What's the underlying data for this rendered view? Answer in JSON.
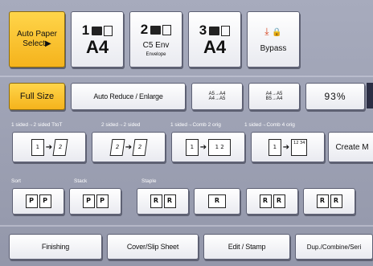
{
  "paper_select": {
    "auto": "Auto Paper\nSelect",
    "auto_line1": "Auto Paper",
    "auto_line2": "Select▶",
    "tray1": {
      "num": "1",
      "size": "A4"
    },
    "tray2": {
      "num": "2",
      "size": "C5 Env",
      "sub": "Envelope"
    },
    "tray3": {
      "num": "3",
      "size": "A4"
    },
    "bypass": "Bypass"
  },
  "zoom": {
    "full": "Full Size",
    "auto_reduce": "Auto Reduce / Enlarge",
    "preset1_a": "A5→A4",
    "preset1_b": "A4→A5",
    "preset2_a": "A4→A5",
    "preset2_b": "B5→A4",
    "percent": "93%"
  },
  "duplex": {
    "labels": [
      "1 sided→2 sided TtoT",
      "2 sided→2 sided",
      "1 sided→Comb 2 orig",
      "1 sided→Comb 4 orig"
    ],
    "create_margin": "Create M"
  },
  "finishing_labels": {
    "sort": "Sort",
    "stack": "Stack",
    "staple": "Staple"
  },
  "bottom_tabs": [
    "Finishing",
    "Cover/Slip Sheet",
    "Edit / Stamp",
    "Dup./Combine/Seri"
  ],
  "colors": {
    "accent_yellow": "#f5b31c",
    "panel": "#9a9eb2"
  }
}
